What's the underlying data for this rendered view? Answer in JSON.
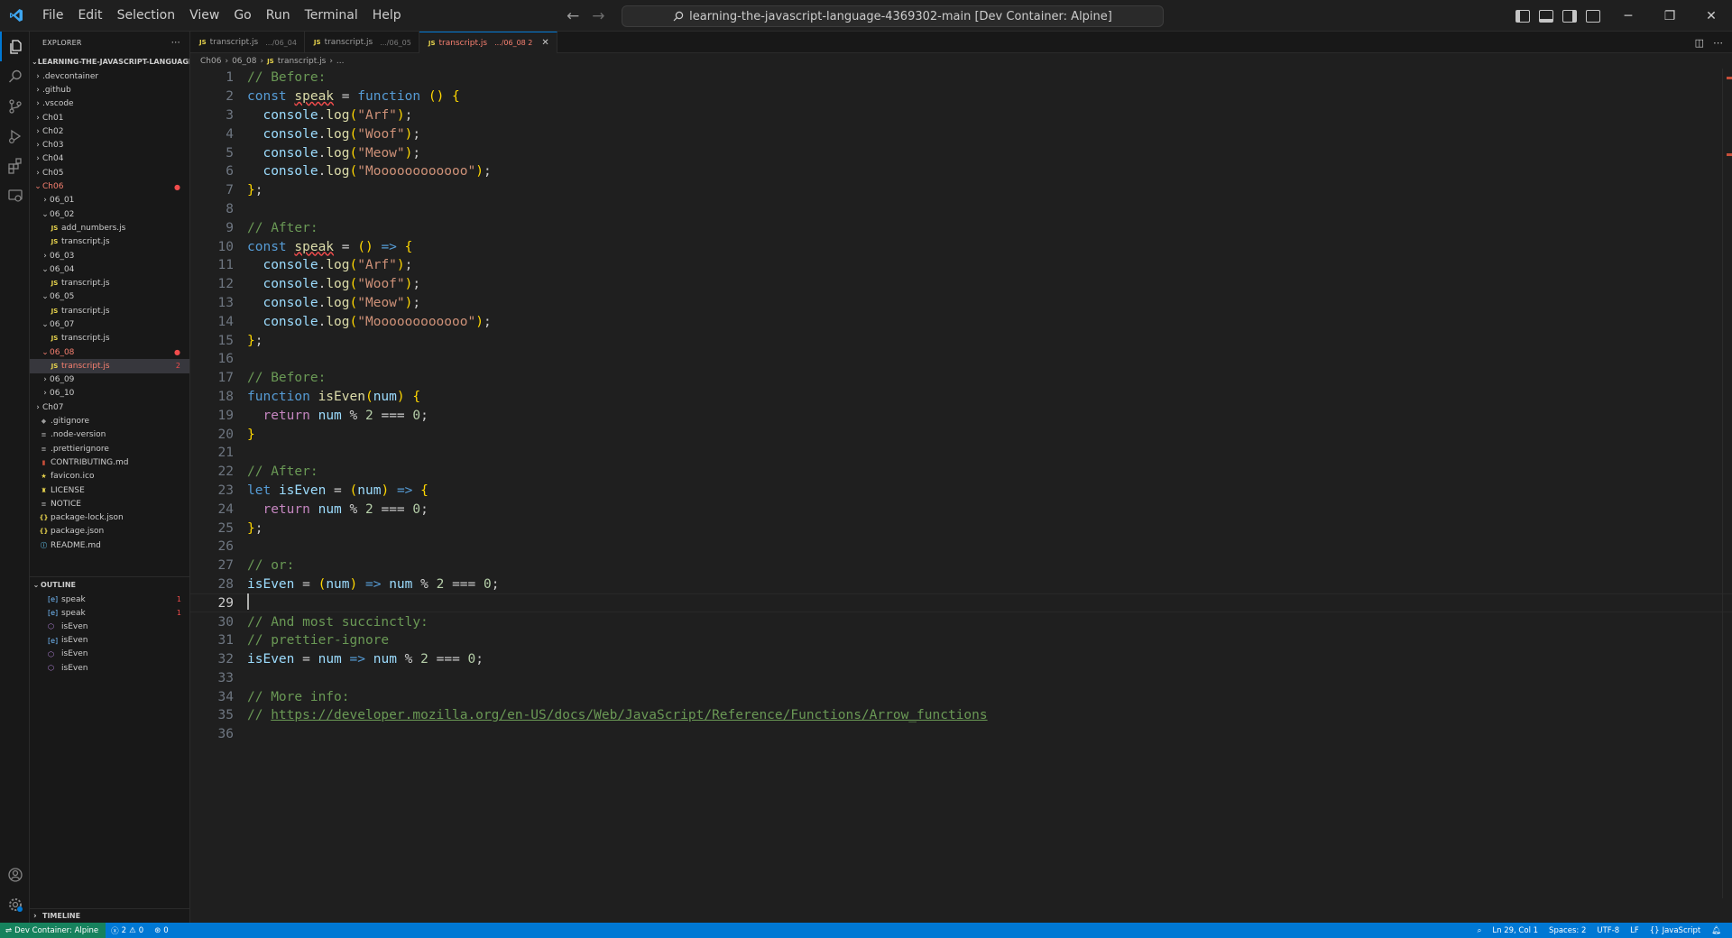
{
  "menu": [
    "File",
    "Edit",
    "Selection",
    "View",
    "Go",
    "Run",
    "Terminal",
    "Help"
  ],
  "command_center": "learning-the-javascript-language-4369302-main [Dev Container: Alpine]",
  "explorer": {
    "header": "EXPLORER",
    "root": "LEARNING-THE-JAVASCRIPT-LANGUAGE-4...",
    "items": [
      {
        "label": ".devcontainer"
      },
      {
        "label": ".github"
      },
      {
        "label": ".vscode"
      },
      {
        "label": "Ch01"
      },
      {
        "label": "Ch02"
      },
      {
        "label": "Ch03"
      },
      {
        "label": "Ch04"
      },
      {
        "label": "Ch05"
      },
      {
        "label": "Ch06"
      },
      {
        "label": "06_01"
      },
      {
        "label": "06_02"
      },
      {
        "label": "add_numbers.js"
      },
      {
        "label": "transcript.js"
      },
      {
        "label": "06_03"
      },
      {
        "label": "06_04"
      },
      {
        "label": "transcript.js"
      },
      {
        "label": "06_05"
      },
      {
        "label": "transcript.js"
      },
      {
        "label": "06_07"
      },
      {
        "label": "transcript.js"
      },
      {
        "label": "06_08"
      },
      {
        "label": "transcript.js",
        "badge": "2"
      },
      {
        "label": "06_09"
      },
      {
        "label": "06_10"
      },
      {
        "label": "Ch07"
      },
      {
        "label": ".gitignore"
      },
      {
        "label": ".node-version"
      },
      {
        "label": ".prettierignore"
      },
      {
        "label": "CONTRIBUTING.md"
      },
      {
        "label": "favicon.ico"
      },
      {
        "label": "LICENSE"
      },
      {
        "label": "NOTICE"
      },
      {
        "label": "package-lock.json"
      },
      {
        "label": "package.json"
      },
      {
        "label": "README.md"
      }
    ]
  },
  "outline": {
    "title": "OUTLINE",
    "items": [
      {
        "label": "speak",
        "badge": "1"
      },
      {
        "label": "speak",
        "badge": "1"
      },
      {
        "label": "isEven"
      },
      {
        "label": "isEven"
      },
      {
        "label": "isEven"
      },
      {
        "label": "isEven"
      }
    ]
  },
  "timeline": "TIMELINE",
  "tabs": [
    {
      "label": "transcript.js",
      "desc": ".../06_04"
    },
    {
      "label": "transcript.js",
      "desc": ".../06_05"
    },
    {
      "label": "transcript.js",
      "desc": ".../06_08 2"
    }
  ],
  "breadcrumb": [
    "Ch06",
    "06_08",
    "transcript.js",
    "..."
  ],
  "code_lines": [
    "// Before:",
    "const speak = function () {",
    "  console.log(\"Arf\");",
    "  console.log(\"Woof\");",
    "  console.log(\"Meow\");",
    "  console.log(\"Moooooooooooo\");",
    "};",
    "",
    "// After:",
    "const speak = () => {",
    "  console.log(\"Arf\");",
    "  console.log(\"Woof\");",
    "  console.log(\"Meow\");",
    "  console.log(\"Moooooooooooo\");",
    "};",
    "",
    "// Before:",
    "function isEven(num) {",
    "  return num % 2 === 0;",
    "}",
    "",
    "// After:",
    "let isEven = (num) => {",
    "  return num % 2 === 0;",
    "};",
    "",
    "// or:",
    "isEven = (num) => num % 2 === 0;",
    "",
    "// And most succinctly:",
    "// prettier-ignore",
    "isEven = num => num % 2 === 0;",
    "",
    "// More info:",
    "// https://developer.mozilla.org/en-US/docs/Web/JavaScript/Reference/Functions/Arrow_functions",
    ""
  ],
  "current_line": 29,
  "status": {
    "remote": "Dev Container: Alpine",
    "errors": "2",
    "warnings": "0",
    "ports": "0",
    "position": "Ln 29, Col 1",
    "spaces": "Spaces: 2",
    "encoding": "UTF-8",
    "eol": "LF",
    "language": "JavaScript"
  },
  "colors": {
    "comment": "#6a9955",
    "keyword": "#569cd6",
    "control": "#c586c0",
    "string": "#ce9178",
    "function": "#dcdcaa",
    "variable": "#9cdcfe",
    "number": "#b5cea8",
    "bracket": "#ffd700",
    "accent": "#0078d4",
    "remote": "#16825d"
  }
}
